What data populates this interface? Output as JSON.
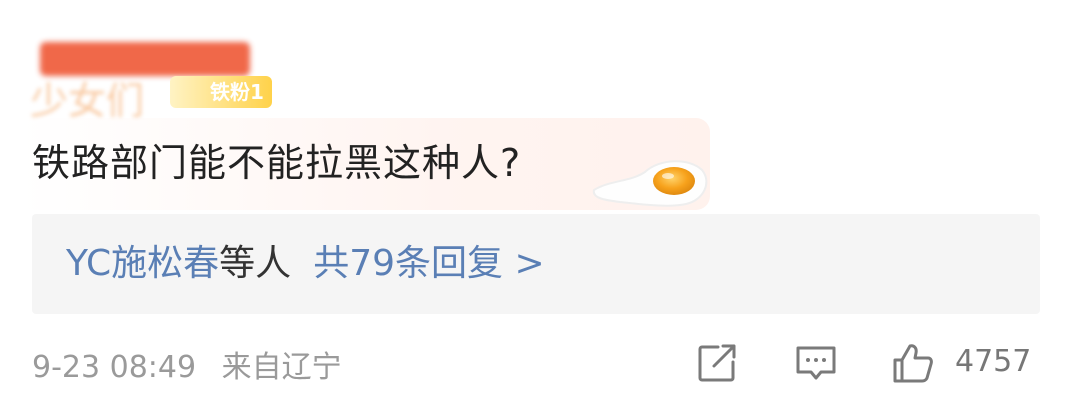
{
  "comment": {
    "username_redacted": "少女们",
    "fan_badge": "铁粉1",
    "text": "铁路部门能不能拉黑这种人?"
  },
  "replies": {
    "names": "YC施松春",
    "suffix": "等人",
    "count_label": "共79条回复 >"
  },
  "meta": {
    "timestamp": "9-23 08:49",
    "location": "来自辽宁",
    "like_count": "4757"
  },
  "icons": {
    "share": "share-icon",
    "comment": "comment-icon",
    "like": "thumbs-up-icon",
    "decoration": "fried-egg-icon"
  },
  "colors": {
    "link_blue": "#5a7fb5",
    "reply_bg": "#f5f5f5",
    "meta_gray": "#9a9a9a"
  }
}
